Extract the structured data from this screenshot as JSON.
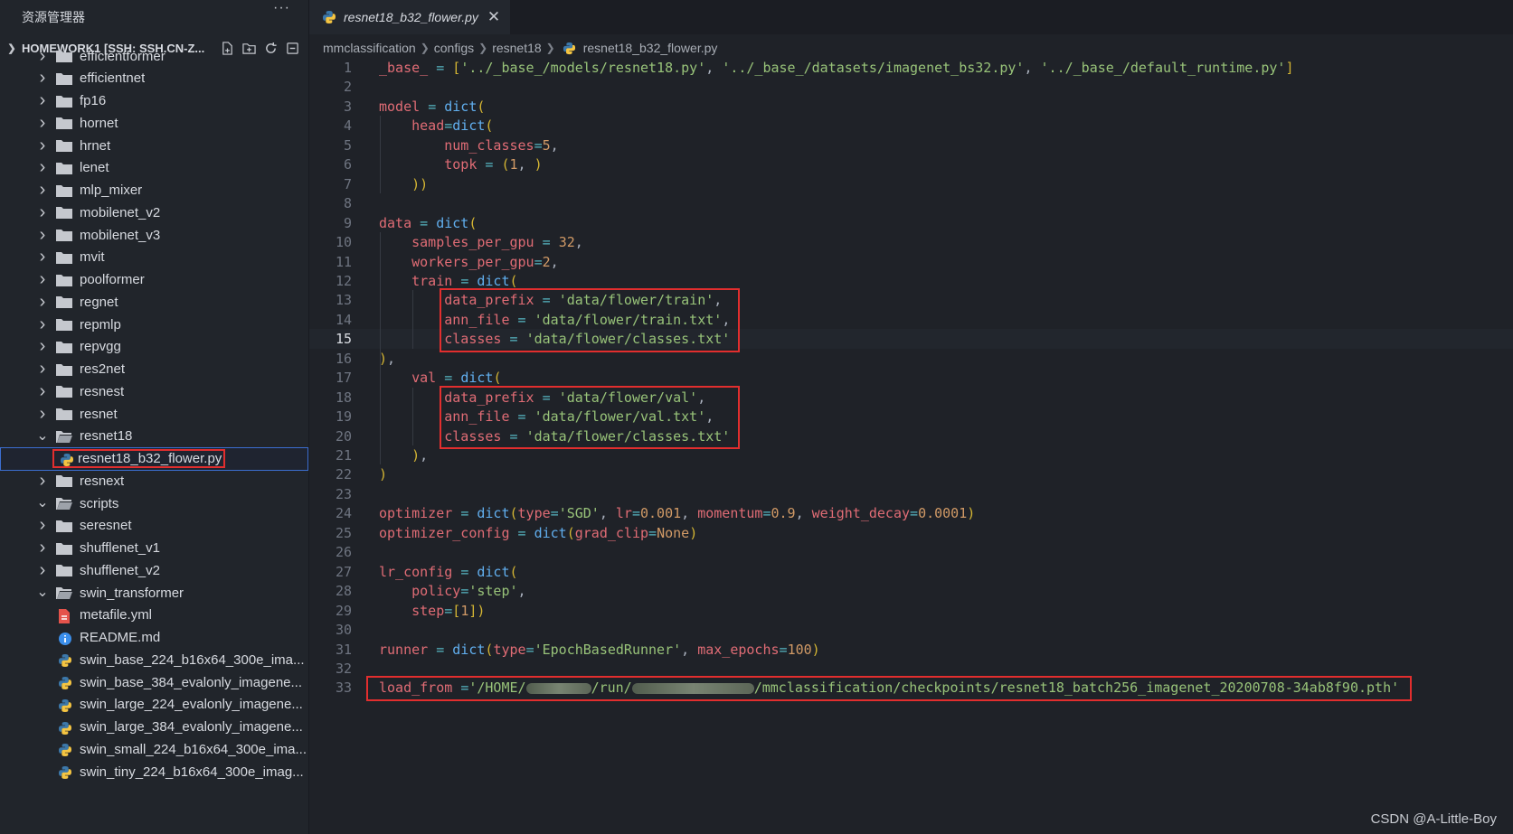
{
  "sidebar": {
    "title": "资源管理器",
    "more": "···",
    "workspace": "HOMEWORK1 [SSH: SSH.CN-Z...",
    "items": [
      {
        "label": "efficientformer",
        "type": "folder"
      },
      {
        "label": "efficientnet",
        "type": "folder"
      },
      {
        "label": "fp16",
        "type": "folder"
      },
      {
        "label": "hornet",
        "type": "folder"
      },
      {
        "label": "hrnet",
        "type": "folder"
      },
      {
        "label": "lenet",
        "type": "folder"
      },
      {
        "label": "mlp_mixer",
        "type": "folder"
      },
      {
        "label": "mobilenet_v2",
        "type": "folder"
      },
      {
        "label": "mobilenet_v3",
        "type": "folder"
      },
      {
        "label": "mvit",
        "type": "folder"
      },
      {
        "label": "poolformer",
        "type": "folder"
      },
      {
        "label": "regnet",
        "type": "folder"
      },
      {
        "label": "repmlp",
        "type": "folder"
      },
      {
        "label": "repvgg",
        "type": "folder"
      },
      {
        "label": "res2net",
        "type": "folder"
      },
      {
        "label": "resnest",
        "type": "folder"
      },
      {
        "label": "resnet",
        "type": "folder"
      },
      {
        "label": "resnet18",
        "type": "folder-open"
      },
      {
        "label": "resnet18_b32_flower.py",
        "type": "python"
      },
      {
        "label": "resnext",
        "type": "folder"
      },
      {
        "label": "scripts",
        "type": "folder-open"
      },
      {
        "label": "seresnet",
        "type": "folder"
      },
      {
        "label": "shufflenet_v1",
        "type": "folder"
      },
      {
        "label": "shufflenet_v2",
        "type": "folder"
      },
      {
        "label": "swin_transformer",
        "type": "folder-open"
      },
      {
        "label": "metafile.yml",
        "type": "yaml"
      },
      {
        "label": "README.md",
        "type": "info"
      },
      {
        "label": "swin_base_224_b16x64_300e_ima...",
        "type": "python"
      },
      {
        "label": "swin_base_384_evalonly_imagene...",
        "type": "python"
      },
      {
        "label": "swin_large_224_evalonly_imagene...",
        "type": "python"
      },
      {
        "label": "swin_large_384_evalonly_imagene...",
        "type": "python"
      },
      {
        "label": "swin_small_224_b16x64_300e_ima...",
        "type": "python"
      },
      {
        "label": "swin_tiny_224_b16x64_300e_imag...",
        "type": "python"
      }
    ]
  },
  "tab": {
    "label": "resnet18_b32_flower.py",
    "close": "✕"
  },
  "breadcrumb": [
    "mmclassification",
    "configs",
    "resnet18",
    "resnet18_b32_flower.py"
  ],
  "editor": {
    "current_line": 15,
    "line_numbers": [
      "1",
      "2",
      "3",
      "4",
      "5",
      "6",
      "7",
      "8",
      "9",
      "10",
      "11",
      "12",
      "13",
      "14",
      "15",
      "16",
      "17",
      "18",
      "19",
      "20",
      "21",
      "22",
      "23",
      "24",
      "25",
      "26",
      "27",
      "28",
      "29",
      "30",
      "31",
      "32",
      "33"
    ],
    "lines": [
      "_base_ = ['../_base_/models/resnet18.py', '../_base_/datasets/imagenet_bs32.py', '../_base_/default_runtime.py']",
      "",
      "model = dict(",
      "    head=dict(",
      "        num_classes=5,",
      "        topk = (1, )",
      "    ))",
      "",
      "data = dict(",
      "    samples_per_gpu = 32,",
      "    workers_per_gpu=2,",
      "    train = dict(",
      "        data_prefix = 'data/flower/train',",
      "        ann_file = 'data/flower/train.txt',",
      "        classes = 'data/flower/classes.txt'",
      "),",
      "    val = dict(",
      "        data_prefix = 'data/flower/val',",
      "        ann_file = 'data/flower/val.txt',",
      "        classes = 'data/flower/classes.txt'",
      "    ),",
      ")",
      "",
      "optimizer = dict(type='SGD', lr=0.001, momentum=0.9, weight_decay=0.0001)",
      "optimizer_config = dict(grad_clip=None)",
      "",
      "lr_config = dict(",
      "    policy='step',",
      "    step=[1])",
      "",
      "runner = dict(type='EpochBasedRunner', max_epochs=100)",
      "",
      "load_from ='/HOME/        /run/               /mmclassification/checkpoints/resnet18_batch256_imagenet_20200708-34ab8f90.pth'"
    ]
  },
  "watermark": "CSDN @A-Little-Boy",
  "colors": {
    "highlight_box": "#e22e2e",
    "selection": "#3c6ed0"
  }
}
